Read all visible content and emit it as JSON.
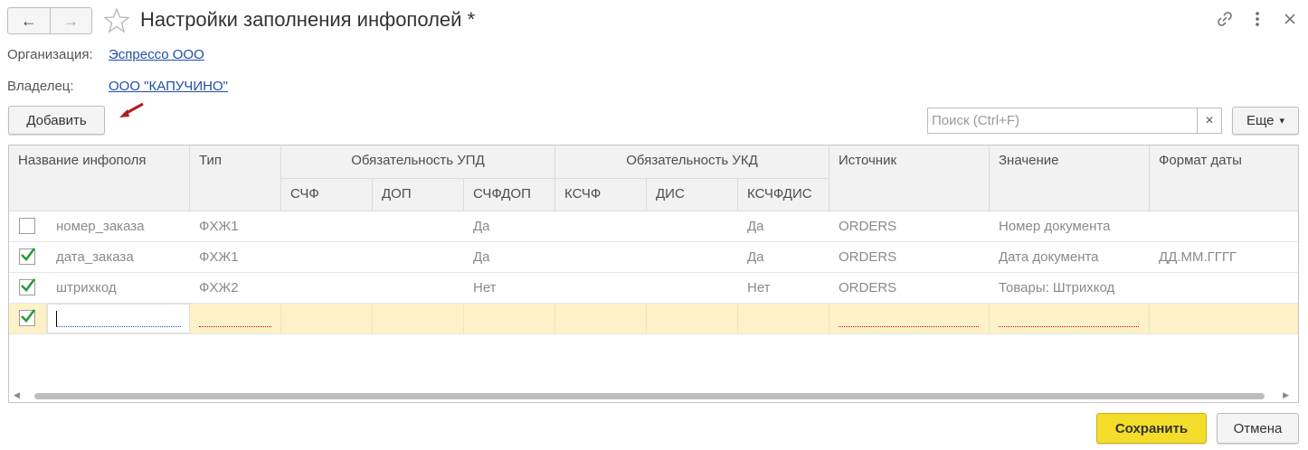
{
  "window": {
    "title": "Настройки заполнения инфополей *",
    "back_icon": "arrow-left-icon",
    "forward_icon": "arrow-right-icon",
    "favorite_icon": "star-icon",
    "link_icon": "link-icon",
    "more_icon": "more-vertical-icon",
    "close_icon": "close-icon"
  },
  "fields": {
    "organization_label": "Организация:",
    "organization_value": "Эспрессо ООО",
    "owner_label": "Владелец:",
    "owner_value": "ООО \"КАПУЧИНО\""
  },
  "toolbar": {
    "add_label": "Добавить",
    "search_placeholder": "Поиск (Ctrl+F)",
    "search_clear": "×",
    "more_label": "Еще",
    "more_arrow": "▾"
  },
  "table": {
    "headers": {
      "name": "Название инфополя",
      "type": "Тип",
      "upd_group": "Обязательность УПД",
      "ukd_group": "Обязательность УКД",
      "source": "Источник",
      "value": "Значение",
      "date_format": "Формат даты",
      "schf": "СЧФ",
      "dop": "ДОП",
      "schfdop": "СЧФДОП",
      "kschf": "КСЧФ",
      "dis": "ДИС",
      "kschfdis": "КСЧФДИС"
    },
    "rows": [
      {
        "checked": false,
        "name": "номер_заказа",
        "type": "ФХЖ1",
        "schf": "",
        "dop": "",
        "schfdop": "Да",
        "kschf": "",
        "dis": "",
        "kschfdis": "Да",
        "source": "ORDERS",
        "value": "Номер документа",
        "date_format": ""
      },
      {
        "checked": true,
        "name": "дата_заказа",
        "type": "ФХЖ1",
        "schf": "",
        "dop": "",
        "schfdop": "Да",
        "kschf": "",
        "dis": "",
        "kschfdis": "Да",
        "source": "ORDERS",
        "value": "Дата документа",
        "date_format": "ДД.ММ.ГГГГ"
      },
      {
        "checked": true,
        "name": "штрихкод",
        "type": "ФХЖ2",
        "schf": "",
        "dop": "",
        "schfdop": "Нет",
        "kschf": "",
        "dis": "",
        "kschfdis": "Нет",
        "source": "ORDERS",
        "value": "Товары: Штрихкод",
        "date_format": ""
      },
      {
        "checked": true,
        "name": "",
        "type": "",
        "schf": "",
        "dop": "",
        "schfdop": "",
        "kschf": "",
        "dis": "",
        "kschfdis": "",
        "source": "",
        "value": "",
        "date_format": ""
      }
    ]
  },
  "footer": {
    "save_label": "Сохранить",
    "cancel_label": "Отмена"
  },
  "colors": {
    "accent_save": "#f4dc2b",
    "selected_row": "#fdf2c7",
    "link": "#1f4ea8",
    "check": "#2a9a3a",
    "annotation_arrow": "#b01c1c"
  }
}
